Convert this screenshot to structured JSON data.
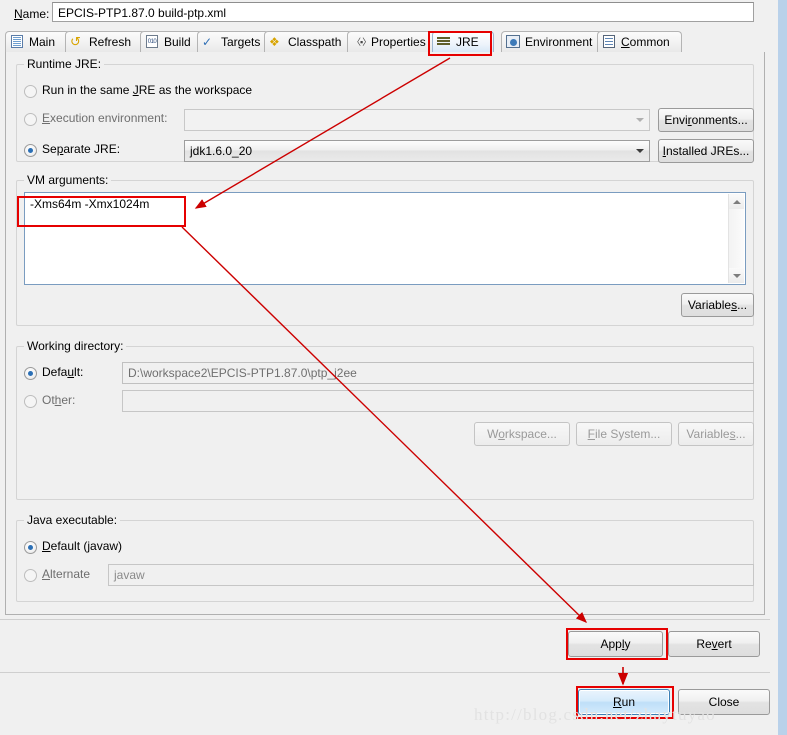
{
  "dialog": {
    "name_label": "Name:",
    "name_value": "EPCIS-PTP1.87.0 build-ptp.xml"
  },
  "tabs": [
    {
      "label": "Main",
      "icon": "document-icon",
      "active": false
    },
    {
      "label": "Refresh",
      "icon": "refresh-icon",
      "active": false
    },
    {
      "label": "Build",
      "icon": "build-icon",
      "active": false
    },
    {
      "label": "Targets",
      "icon": "targets-icon",
      "active": false
    },
    {
      "label": "Classpath",
      "icon": "classpath-icon",
      "active": false
    },
    {
      "label": "Properties",
      "icon": "properties-icon",
      "active": false
    },
    {
      "label": "JRE",
      "icon": "jre-icon",
      "active": true
    },
    {
      "label": "Environment",
      "icon": "environment-icon",
      "active": false
    },
    {
      "label": "Common",
      "icon": "common-icon",
      "active": false
    }
  ],
  "runtime_jre": {
    "group_title": "Runtime JRE:",
    "option_same_workspace": "Run in the same JRE as the workspace",
    "option_execution_environment": "Execution environment:",
    "option_separate_jre": "Separate JRE:",
    "selected": "separate_jre",
    "execution_environment_value": "",
    "separate_jre_value": "jdk1.6.0_20",
    "environments_button": "Environments...",
    "installed_jres_button": "Installed JREs..."
  },
  "vm_arguments": {
    "group_title": "VM arguments:",
    "value": "-Xms64m -Xmx1024m",
    "variables_button": "Variables..."
  },
  "working_directory": {
    "group_title": "Working directory:",
    "option_default": "Default:",
    "option_other": "Other:",
    "selected": "default",
    "default_value": "D:\\workspace2\\EPCIS-PTP1.87.0\\ptp_j2ee",
    "other_value": "",
    "workspace_button": "Workspace...",
    "file_system_button": "File System...",
    "variables_button": "Variables..."
  },
  "java_executable": {
    "group_title": "Java executable:",
    "option_default": "Default (javaw)",
    "option_alternate": "Alternate",
    "selected": "default",
    "alternate_value": "javaw"
  },
  "footer": {
    "apply_button": "Apply",
    "revert_button": "Revert",
    "run_button": "Run",
    "close_button": "Close"
  },
  "annotations": {
    "highlight_color": "#e60000",
    "watermark": "http://blog.csdn.net/zhaytuyao"
  }
}
